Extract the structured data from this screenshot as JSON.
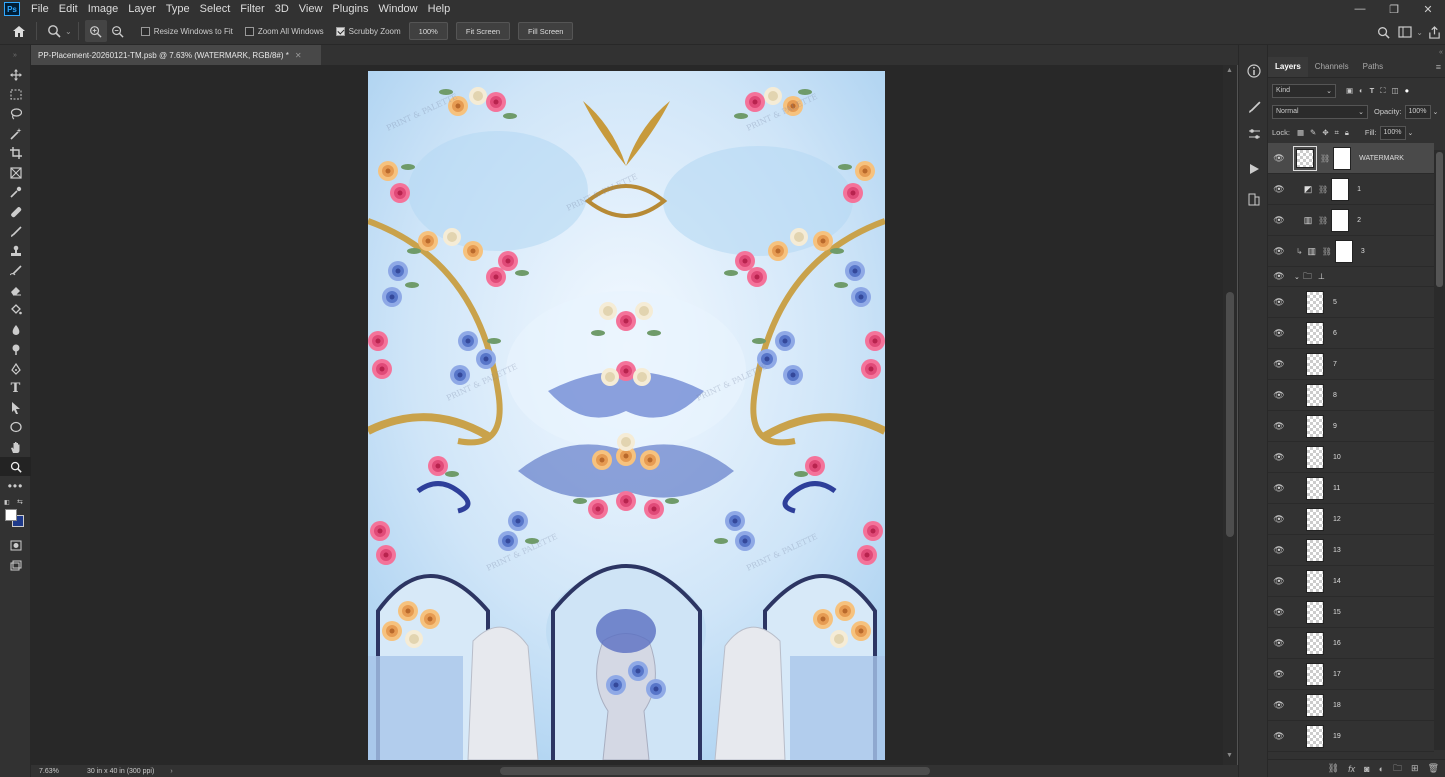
{
  "menubar": {
    "logo": "Ps",
    "items": [
      "File",
      "Edit",
      "Image",
      "Layer",
      "Type",
      "Select",
      "Filter",
      "3D",
      "View",
      "Plugins",
      "Window",
      "Help"
    ]
  },
  "options": {
    "resize_windows": "Resize Windows to Fit",
    "zoom_all": "Zoom All Windows",
    "scrubby": "Scrubby Zoom",
    "zoom_100": "100%",
    "fit_screen": "Fit Screen",
    "fill_screen": "Fill Screen"
  },
  "document": {
    "tab_title": "PP-Placement-20260121-TM.psb @ 7.63% (WATERMARK, RGB/8#) *",
    "zoom": "7.63%",
    "doc_info": "30 in x 40 in (300 ppi)",
    "watermark_text": "PRINT & PALETTE"
  },
  "colors": {
    "foreground": "#ffffff",
    "background": "#1f3a8a",
    "accent": "#31a8ff"
  },
  "panel": {
    "tabs": [
      "Layers",
      "Channels",
      "Paths"
    ],
    "filter_kind": "Kind",
    "blend_mode": "Normal",
    "opacity_label": "Opacity:",
    "opacity_value": "100%",
    "lock_label": "Lock:",
    "fill_label": "Fill:",
    "fill_value": "100%",
    "layers": [
      {
        "name": "WATERMARK",
        "kind": "smart",
        "selected": true
      },
      {
        "name": "1",
        "kind": "adjust"
      },
      {
        "name": "2",
        "kind": "adjust"
      },
      {
        "name": "3",
        "kind": "clipped"
      },
      {
        "name": "",
        "kind": "group"
      },
      {
        "name": "5",
        "kind": "pixel"
      },
      {
        "name": "6",
        "kind": "pixel"
      },
      {
        "name": "7",
        "kind": "pixel"
      },
      {
        "name": "8",
        "kind": "pixel"
      },
      {
        "name": "9",
        "kind": "pixel"
      },
      {
        "name": "10",
        "kind": "pixel"
      },
      {
        "name": "11",
        "kind": "pixel"
      },
      {
        "name": "12",
        "kind": "pixel"
      },
      {
        "name": "13",
        "kind": "pixel"
      },
      {
        "name": "14",
        "kind": "pixel"
      },
      {
        "name": "15",
        "kind": "pixel"
      },
      {
        "name": "16",
        "kind": "pixel"
      },
      {
        "name": "17",
        "kind": "pixel"
      },
      {
        "name": "18",
        "kind": "pixel"
      },
      {
        "name": "19",
        "kind": "pixel"
      }
    ]
  }
}
